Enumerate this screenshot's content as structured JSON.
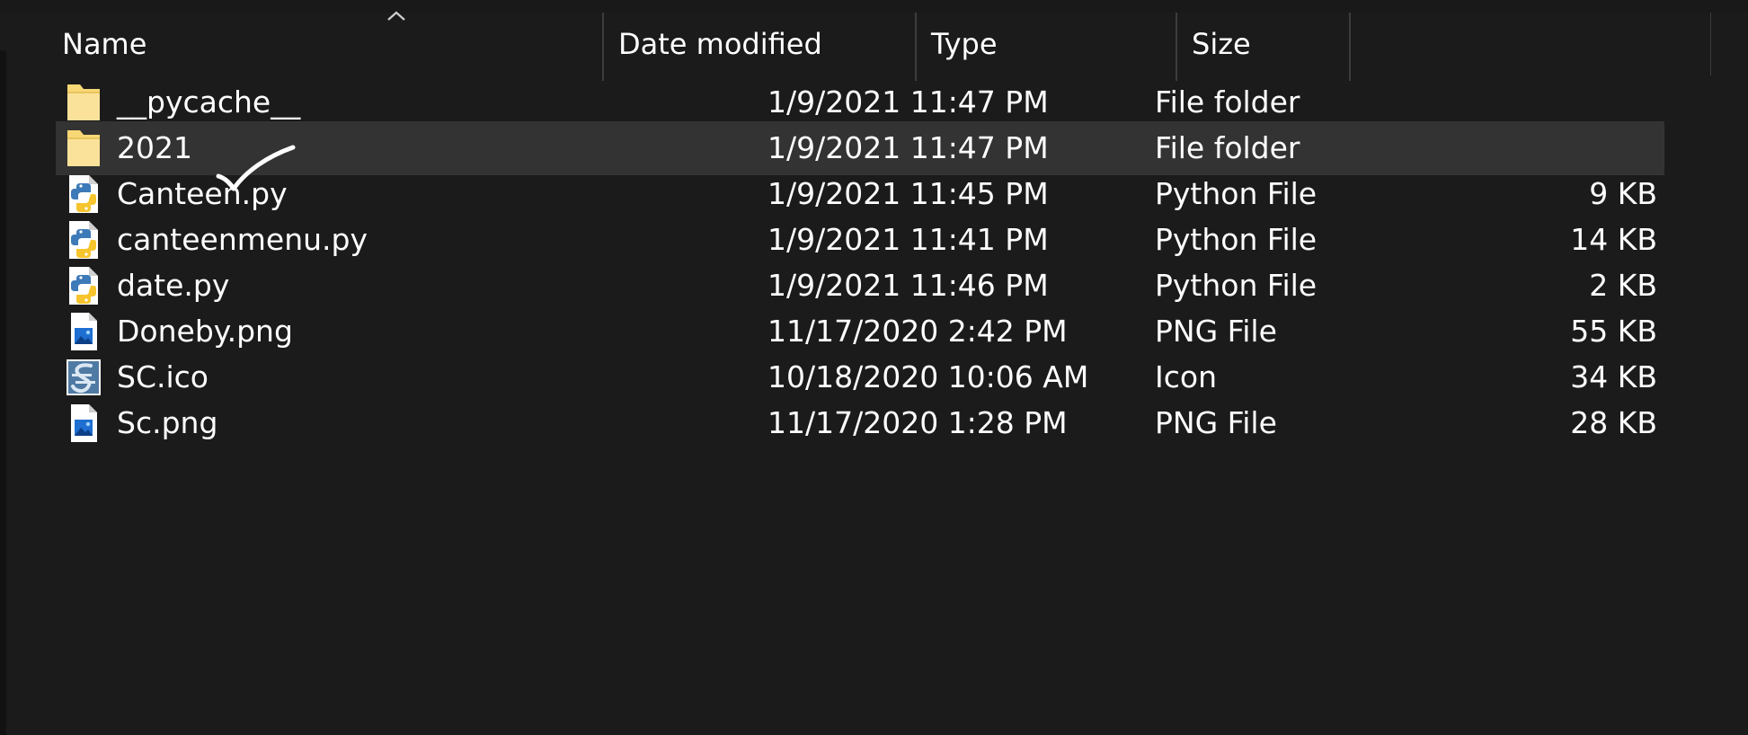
{
  "columns": {
    "name": "Name",
    "date_modified": "Date modified",
    "type": "Type",
    "size": "Size"
  },
  "files": [
    {
      "name": "__pycache__",
      "date": "1/9/2021 11:47 PM",
      "type": "File folder",
      "size": "",
      "icon": "folder-icon",
      "selected": false
    },
    {
      "name": "2021",
      "date": "1/9/2021 11:47 PM",
      "type": "File folder",
      "size": "",
      "icon": "folder-icon",
      "selected": true
    },
    {
      "name": "Canteen.py",
      "date": "1/9/2021 11:45 PM",
      "type": "Python File",
      "size": "9 KB",
      "icon": "python-file-icon",
      "selected": false
    },
    {
      "name": "canteenmenu.py",
      "date": "1/9/2021 11:41 PM",
      "type": "Python File",
      "size": "14 KB",
      "icon": "python-file-icon",
      "selected": false
    },
    {
      "name": "date.py",
      "date": "1/9/2021 11:46 PM",
      "type": "Python File",
      "size": "2 KB",
      "icon": "python-file-icon",
      "selected": false
    },
    {
      "name": "Doneby.png",
      "date": "11/17/2020 2:42 PM",
      "type": "PNG File",
      "size": "55 KB",
      "icon": "image-file-icon",
      "selected": false
    },
    {
      "name": "SC.ico",
      "date": "10/18/2020 10:06 AM",
      "type": "Icon",
      "size": "34 KB",
      "icon": "ico-file-icon",
      "selected": false
    },
    {
      "name": "Sc.png",
      "date": "11/17/2020 1:28 PM",
      "type": "PNG File",
      "size": "28 KB",
      "icon": "image-file-icon",
      "selected": false
    }
  ],
  "annotation": "checkmark-icon",
  "colors": {
    "background": "#1b1b1b",
    "selected_row": "#333333",
    "folder": "#f8d775",
    "text": "#ffffff"
  }
}
